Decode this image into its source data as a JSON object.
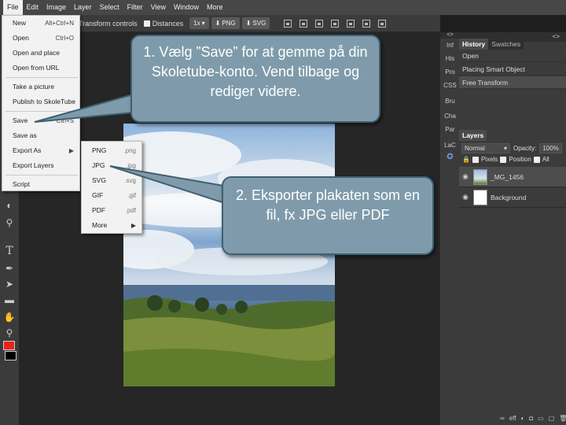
{
  "menubar": [
    "File",
    "Edit",
    "Image",
    "Layer",
    "Select",
    "Filter",
    "View",
    "Window",
    "More"
  ],
  "toolbar": {
    "transform_controls": "Transform controls",
    "distances": "Distances",
    "zoom": "1x",
    "png": "PNG",
    "svg": "SVG"
  },
  "file_menu": {
    "items": [
      {
        "label": "New",
        "shortcut": "Alt+Ctrl+N"
      },
      {
        "label": "Open",
        "shortcut": "Ctrl+O"
      },
      {
        "label": "Open and place",
        "shortcut": ""
      },
      {
        "label": "Open from URL",
        "shortcut": ""
      },
      {
        "label": "Take a picture",
        "shortcut": ""
      },
      {
        "label": "Publish to SkoleTube",
        "shortcut": ""
      },
      {
        "label": "Save",
        "shortcut": "Ctrl+S"
      },
      {
        "label": "Save as",
        "shortcut": ""
      },
      {
        "label": "Export As",
        "shortcut": ""
      },
      {
        "label": "Export Layers",
        "shortcut": ""
      },
      {
        "label": "Script",
        "shortcut": ""
      }
    ]
  },
  "export_submenu": [
    {
      "label": "PNG",
      "ext": ".png"
    },
    {
      "label": "JPG",
      "ext": ".jpg"
    },
    {
      "label": "SVG",
      "ext": ".svg"
    },
    {
      "label": "GIF",
      "ext": ".gif"
    },
    {
      "label": "PDF",
      "ext": ".pdf"
    },
    {
      "label": "More",
      "ext": ""
    }
  ],
  "right_narrow": [
    "Inf",
    "His",
    "Pro",
    "CSS",
    "Bru",
    "Cha",
    "Par",
    "LaC"
  ],
  "history_panel": {
    "tabs": [
      "History",
      "Swatches"
    ],
    "rows": [
      "Open",
      "Placing Smart Object",
      "Free Transform"
    ]
  },
  "layers_panel": {
    "tab": "Layers",
    "blend_mode": "Normal",
    "opacity_label": "Opacity:",
    "opacity_value": "100%",
    "lock_pixels": "Pixels",
    "lock_position": "Position",
    "lock_all": "All",
    "layers": [
      "_MG_1456",
      "Background"
    ]
  },
  "callouts": {
    "save": "1. Vælg ”Save” for at gemme på din Skoletube-konto. Vend tilbage og rediger videre.",
    "export": "2. Eksporter plakaten som en fil, fx JPG eller PDF"
  },
  "colors": {
    "foreground": "#e8231c",
    "background": "#000000",
    "callout_fill": "#7f9bab",
    "callout_border": "#3f6070"
  },
  "icons": [
    "tool-gradient-icon",
    "tool-dodge-icon",
    "tool-text-icon",
    "tool-pen-icon",
    "tool-select-icon",
    "tool-shape-icon",
    "tool-hand-icon",
    "tool-zoom-icon"
  ]
}
